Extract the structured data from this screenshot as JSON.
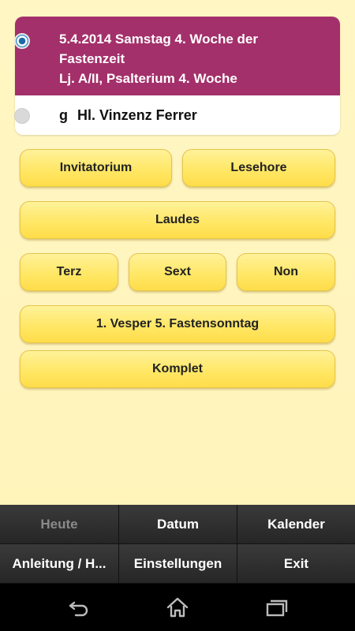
{
  "selection": {
    "option1": {
      "line1": "5.4.2014   Samstag 4. Woche der",
      "line2": "Fastenzeit",
      "line3": "Lj. A/II, Psalterium 4. Woche",
      "selected": true
    },
    "option2": {
      "rank": "g",
      "label": "Hl. Vinzenz Ferrer",
      "selected": false
    }
  },
  "hours": {
    "invitatorium": "Invitatorium",
    "lesehore": "Lesehore",
    "laudes": "Laudes",
    "terz": "Terz",
    "sext": "Sext",
    "non": "Non",
    "vesper": "1. Vesper 5. Fastensonntag",
    "komplet": "Komplet"
  },
  "menu": {
    "heute": "Heute",
    "datum": "Datum",
    "kalender": "Kalender",
    "anleitung": "Anleitung / H...",
    "einstellungen": "Einstellungen",
    "exit": "Exit"
  },
  "colors": {
    "selected_background": "#a3306a",
    "button_yellow": "#ffe766",
    "page_background": "#fff6c4"
  },
  "navbar": {
    "icons": [
      "back-icon",
      "home-icon",
      "recent-apps-icon"
    ]
  }
}
